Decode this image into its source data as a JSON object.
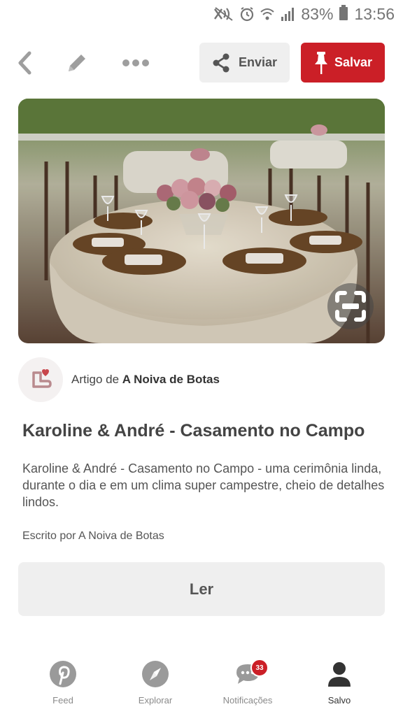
{
  "status_bar": {
    "battery_percent": "83%",
    "time": "13:56"
  },
  "toolbar": {
    "send_label": "Enviar",
    "save_label": "Salvar"
  },
  "source": {
    "prefix": "Artigo de",
    "name": "A Noiva de Botas"
  },
  "article": {
    "title": "Karoline & André - Casamento no Campo",
    "description": "Karoline & André - Casamento no Campo - uma cerimônia linda, durante o dia e em um clima super campestre, cheio de detalhes lindos.",
    "author": "Escrito por A Noiva de Botas"
  },
  "read_button": {
    "label": "Ler"
  },
  "bottom_nav": {
    "items": [
      {
        "label": "Feed",
        "icon": "pinterest-icon"
      },
      {
        "label": "Explorar",
        "icon": "compass-icon"
      },
      {
        "label": "Notificações",
        "icon": "chat-bubble-icon",
        "badge": "33"
      },
      {
        "label": "Salvo",
        "icon": "profile-icon"
      }
    ]
  },
  "colors": {
    "brand_red": "#cb1f27",
    "button_gray": "#efefef",
    "text_dark": "#444444"
  }
}
